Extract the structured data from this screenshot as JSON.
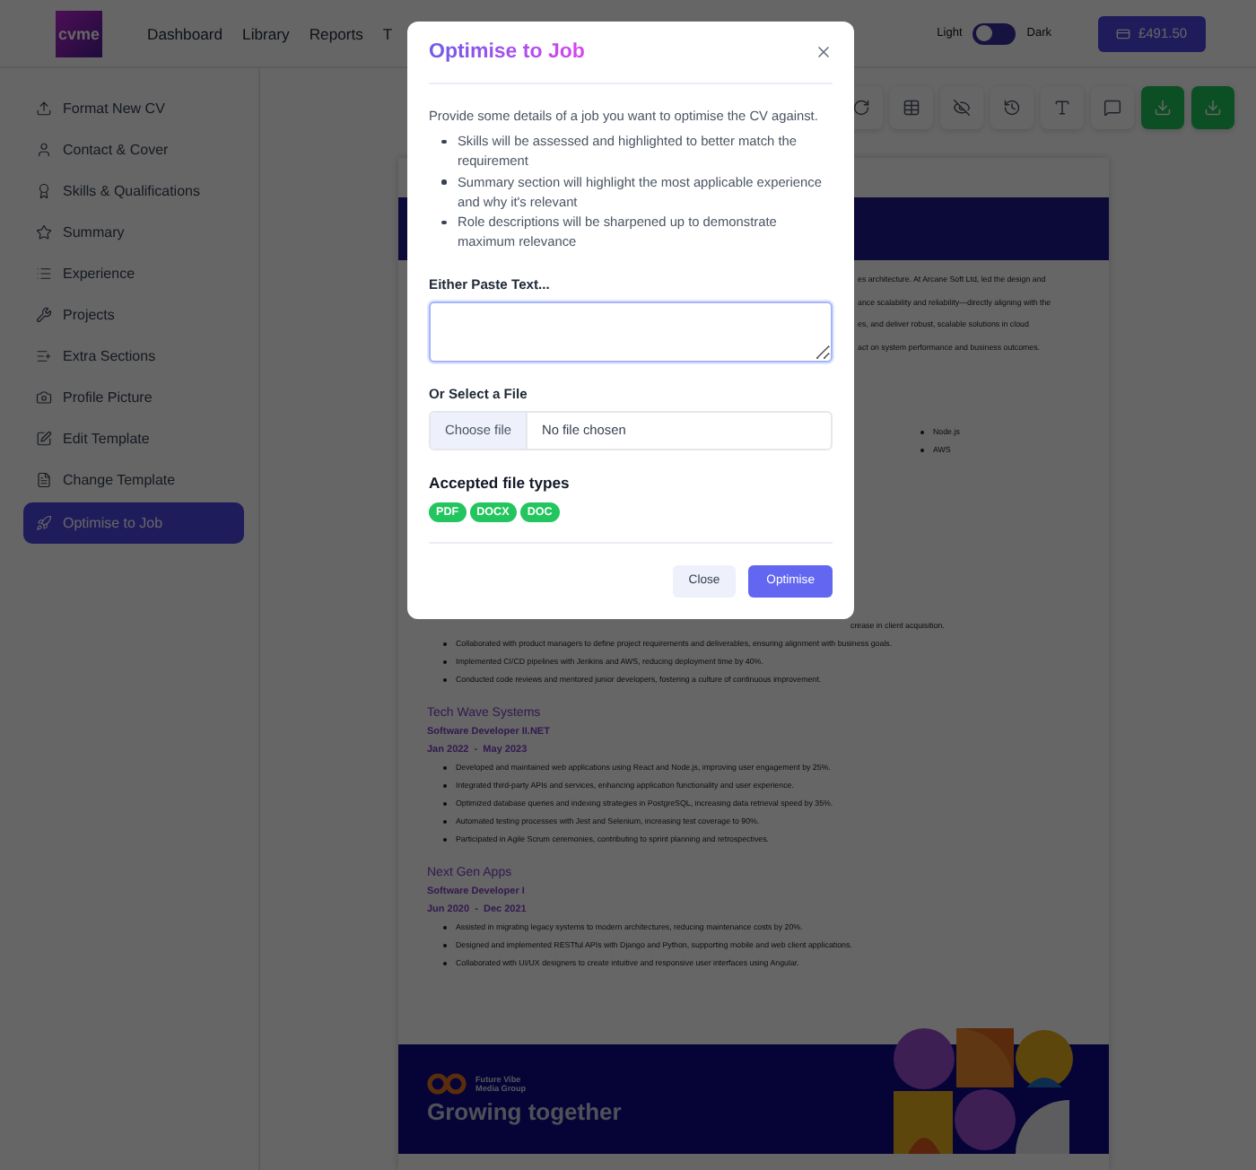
{
  "top_bar": {
    "logo": "cvme",
    "nav": [
      "Dashboard",
      "Library",
      "Reports",
      "T"
    ],
    "theme_toggle": {
      "light_label": "Light",
      "dark_label": "Dark",
      "dark_mode": false
    },
    "balance": "£491.50"
  },
  "sidebar": {
    "items": [
      {
        "label": "Format New CV",
        "selected": false
      },
      {
        "label": "Contact & Cover",
        "selected": false
      },
      {
        "label": "Skills & Qualifications",
        "selected": false
      },
      {
        "label": "Summary",
        "selected": false
      },
      {
        "label": "Experience",
        "selected": false
      },
      {
        "label": "Projects",
        "selected": false
      },
      {
        "label": "Extra Sections",
        "selected": false
      },
      {
        "label": "Profile Picture",
        "selected": false
      },
      {
        "label": "Edit Template",
        "selected": false
      },
      {
        "label": "Change Template",
        "selected": false
      },
      {
        "label": "Optimise to Job",
        "selected": true
      }
    ]
  },
  "document": {
    "summary_lines": [
      "es architecture. At Arcane Soft Ltd, led the design and",
      "ance scalability and reliability—directly aligning with the",
      "es, and deliver robust, scalable solutions in cloud",
      "act on system performance and business outcomes."
    ],
    "skills": [
      "Node.js",
      "AWS"
    ],
    "first_job": {
      "cut_line": "crease in client acquisition.",
      "bullets": [
        "Collaborated with product managers to define project requirements and deliverables, ensuring alignment with business goals.",
        "Implemented CI/CD pipelines with Jenkins and AWS, reducing deployment time by 40%.",
        "Conducted code reviews and mentored junior developers, fostering a culture of continuous improvement."
      ]
    },
    "jobs": [
      {
        "company": "Tech Wave Systems",
        "role": "Software Developer II.NET",
        "dates": "Jan 2022  -  May 2023",
        "bullets": [
          "Developed and maintained web applications using React and Node.js, improving user engagement by 25%.",
          "Integrated third-party APIs and services, enhancing application functionality and user experience.",
          "Optimized database queries and indexing strategies in PostgreSQL, increasing data retrieval speed by 35%.",
          "Automated testing processes with Jest and Selenium, increasing test coverage to 90%.",
          "Participated in Agile Scrum ceremonies, contributing to sprint planning and retrospectives."
        ]
      },
      {
        "company": "Next Gen Apps",
        "role": "Software Developer I",
        "dates": "Jun 2020  -  Dec 2021",
        "bullets": [
          "Assisted in migrating legacy systems to modern architectures, reducing maintenance costs by 20%.",
          "Designed and implemented RESTful APIs with Django and Python, supporting mobile and web client applications.",
          "Collaborated with UI/UX designers to create intuitive and responsive user interfaces using Angular."
        ]
      }
    ],
    "banner": {
      "company_lines": [
        "Future Vibe",
        "Media Group"
      ],
      "tagline": "Growing together"
    }
  },
  "modal": {
    "title": "Optimise to Job",
    "intro": "Provide some details of a job you want to optimise the CV against.",
    "points": [
      "Skills will be assessed and highlighted to better match the requirement",
      "Summary section will highlight the most applicable experience and why it's relevant",
      "Role descriptions will be sharpened up to demonstrate maximum relevance"
    ],
    "paste_label": "Either Paste Text...",
    "file_label": "Or Select a File",
    "choose_file": "Choose file",
    "file_status": "No file chosen",
    "accepted_heading": "Accepted file types",
    "file_types": [
      "PDF",
      "DOCX",
      "DOC"
    ],
    "buttons": {
      "close": "Close",
      "confirm": "Optimise"
    }
  }
}
